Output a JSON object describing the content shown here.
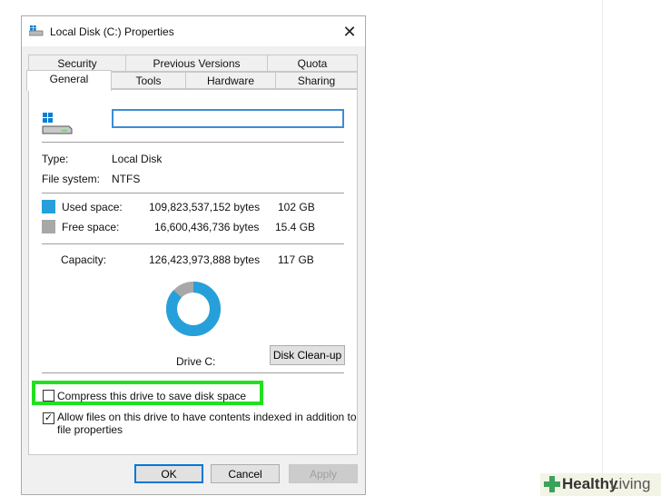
{
  "window": {
    "title": "Local Disk (C:) Properties",
    "close_glyph": "✕"
  },
  "tabs_row1": [
    {
      "label": "Security"
    },
    {
      "label": "Previous Versions"
    },
    {
      "label": "Quota"
    }
  ],
  "tabs_row2": [
    {
      "label": "General",
      "active": true
    },
    {
      "label": "Tools"
    },
    {
      "label": "Hardware"
    },
    {
      "label": "Sharing"
    }
  ],
  "general": {
    "drive_name": "",
    "type_label": "Type:",
    "type_value": "Local Disk",
    "fs_label": "File system:",
    "fs_value": "NTFS",
    "used_label": "Used space:",
    "used_bytes": "109,823,537,152 bytes",
    "used_gb": "102 GB",
    "free_label": "Free space:",
    "free_bytes": "16,600,436,736 bytes",
    "free_gb": "15.4 GB",
    "capacity_label": "Capacity:",
    "capacity_bytes": "126,423,973,888 bytes",
    "capacity_gb": "117 GB",
    "drive_caption": "Drive C:",
    "cleanup_label": "Disk Clean-up",
    "compress_label": "Compress this drive to save disk space",
    "compress_checked": false,
    "index_label_line1": "Allow files on this drive to have contents indexed in addition to",
    "index_label_line2": "file properties",
    "index_checked": true,
    "used_fraction": 0.869
  },
  "colors": {
    "used": "#26a0da",
    "free": "#a8a8a8",
    "highlight": "#22e01f"
  },
  "buttons": {
    "ok": "OK",
    "cancel": "Cancel",
    "apply": "Apply"
  },
  "watermark": {
    "part1": "Healthy",
    "part2": "Living"
  }
}
